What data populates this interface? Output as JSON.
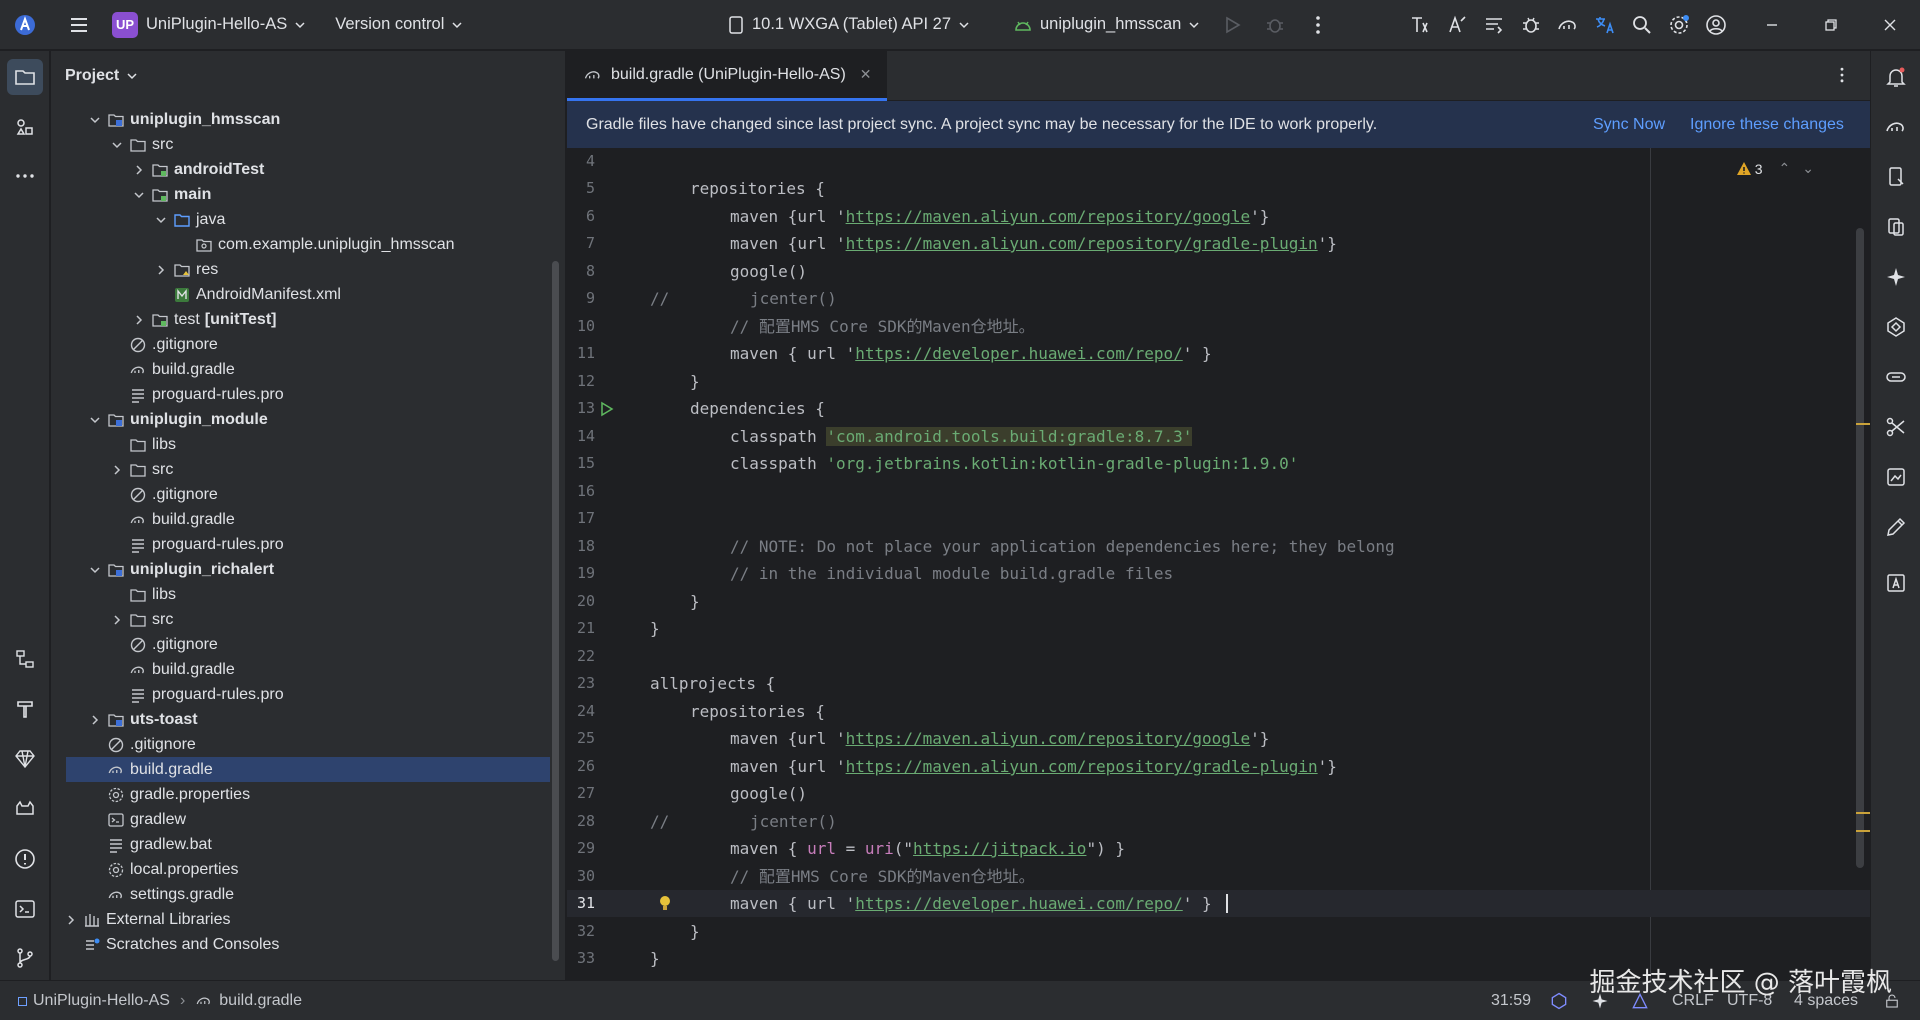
{
  "topbar": {
    "project_badge": "UP",
    "project_name": "UniPlugin-Hello-AS",
    "vcs_label": "Version control",
    "device_label": "10.1  WXGA (Tablet) API 27",
    "run_config": "uniplugin_hmsscan"
  },
  "project_panel": {
    "title": "Project",
    "rows": [
      {
        "label": "uniplugin_hmsscan",
        "bold": true
      },
      {
        "label": "src"
      },
      {
        "label": "androidTest",
        "bold": true
      },
      {
        "label": "main",
        "bold": true
      },
      {
        "label": "java"
      },
      {
        "label": "com.example.uniplugin_hmsscan"
      },
      {
        "label": "res"
      },
      {
        "label": "AndroidManifest.xml"
      },
      {
        "label": "test",
        "suffix": "[unitTest]"
      },
      {
        "label": ".gitignore"
      },
      {
        "label": "build.gradle"
      },
      {
        "label": "proguard-rules.pro"
      },
      {
        "label": "uniplugin_module",
        "bold": true
      },
      {
        "label": "libs"
      },
      {
        "label": "src"
      },
      {
        "label": ".gitignore"
      },
      {
        "label": "build.gradle"
      },
      {
        "label": "proguard-rules.pro"
      },
      {
        "label": "uniplugin_richalert",
        "bold": true
      },
      {
        "label": "libs"
      },
      {
        "label": "src"
      },
      {
        "label": ".gitignore"
      },
      {
        "label": "build.gradle"
      },
      {
        "label": "proguard-rules.pro"
      },
      {
        "label": "uts-toast",
        "bold": true
      },
      {
        "label": ".gitignore"
      },
      {
        "label": "build.gradle"
      },
      {
        "label": "gradle.properties"
      },
      {
        "label": "gradlew"
      },
      {
        "label": "gradlew.bat"
      },
      {
        "label": "local.properties"
      },
      {
        "label": "settings.gradle"
      },
      {
        "label": "External Libraries"
      },
      {
        "label": "Scratches and Consoles"
      }
    ]
  },
  "editor": {
    "tab_label": "build.gradle (UniPlugin-Hello-AS)",
    "banner_text": "Gradle files have changed since last project sync. A project sync may be necessary for the IDE to work properly.",
    "sync_now": "Sync Now",
    "ignore_changes": "Ignore these changes",
    "warning_count": "3",
    "line_numbers": [
      "4",
      "5",
      "6",
      "7",
      "8",
      "9",
      "10",
      "11",
      "12",
      "13",
      "14",
      "15",
      "16",
      "17",
      "18",
      "19",
      "20",
      "21",
      "22",
      "23",
      "24",
      "25",
      "26",
      "27",
      "28",
      "29",
      "30",
      "31",
      "32",
      "33"
    ],
    "code": {
      "repositories": "repositories {",
      "maven_url_open": "maven {url '",
      "maven_url_open_sp": "maven { url '",
      "url_google": "https://maven.aliyun.com/repository/google",
      "url_gradle_plugin": "https://maven.aliyun.com/repository/gradle-plugin",
      "url_close": "'}",
      "url_close_sp": "' }",
      "google": "google()",
      "jcenter": "jcenter()",
      "comment_slash": "//",
      "comment_hms": "// 配置HMS Core SDK的Maven仓地址。",
      "url_huawei": "https://developer.huawei.com/repo/",
      "brace_close": "}",
      "dependencies": "dependencies {",
      "classpath": "classpath ",
      "dep_gradle": "'com.android.tools.build:gradle:8.7.3'",
      "dep_kotlin": "'org.jetbrains.kotlin:kotlin-gradle-plugin:1.9.0'",
      "note1": "// NOTE: Do not place your application dependencies here; they belong",
      "note2": "// in the individual module build.gradle files",
      "allprojects": "allprojects {",
      "maven_jitpack_a": "maven { ",
      "maven_jitpack_url": "url",
      "maven_jitpack_b": " = ",
      "maven_jitpack_uri": "uri",
      "maven_jitpack_c": "(\"",
      "url_jitpack": "https://jitpack.io",
      "maven_jitpack_d": "\") }"
    }
  },
  "statusbar": {
    "project": "UniPlugin-Hello-AS",
    "file": "build.gradle",
    "position": "31:59",
    "line_sep": "CRLF",
    "encoding": "UTF-8",
    "indent": "4 spaces"
  },
  "watermark": "掘金技术社区 @ 落叶霞枫"
}
